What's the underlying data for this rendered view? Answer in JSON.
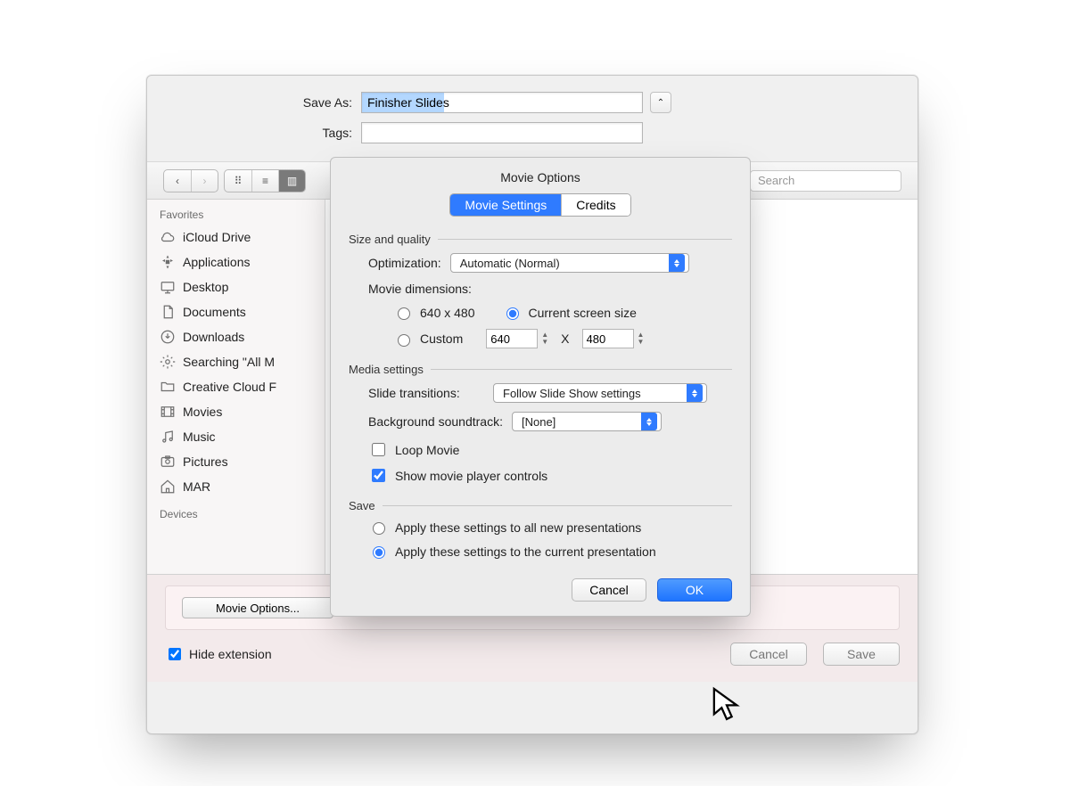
{
  "save_dialog": {
    "save_as_label": "Save As:",
    "save_as_value": "Finisher Slides",
    "tags_label": "Tags:",
    "tags_value": "",
    "search_placeholder": "Search",
    "favorites_header": "Favorites",
    "devices_header": "Devices",
    "favorites": [
      {
        "label": "iCloud Drive",
        "icon": "cloud"
      },
      {
        "label": "Applications",
        "icon": "apps"
      },
      {
        "label": "Desktop",
        "icon": "desktop"
      },
      {
        "label": "Documents",
        "icon": "document"
      },
      {
        "label": "Downloads",
        "icon": "download"
      },
      {
        "label": "Searching \"All M",
        "icon": "gear"
      },
      {
        "label": "Creative Cloud F",
        "icon": "folder"
      },
      {
        "label": "Movies",
        "icon": "movie"
      },
      {
        "label": "Music",
        "icon": "music"
      },
      {
        "label": "Pictures",
        "icon": "picture"
      },
      {
        "label": "MAR",
        "icon": "home"
      }
    ],
    "movie_options_button": "Movie Options...",
    "hide_extension_label": "Hide extension",
    "hide_extension_checked": true,
    "cancel_label": "Cancel",
    "save_label": "Save"
  },
  "sheet": {
    "title": "Movie Options",
    "tabs": {
      "active": "Movie Settings",
      "other": "Credits"
    },
    "size_quality": {
      "header": "Size and quality",
      "optimization_label": "Optimization:",
      "optimization_value": "Automatic (Normal)",
      "dimensions_label": "Movie dimensions:",
      "radio_640": "640 x 480",
      "radio_current": "Current screen size",
      "radio_custom": "Custom",
      "custom_w": "640",
      "custom_x": "X",
      "custom_h": "480",
      "selected": "current"
    },
    "media": {
      "header": "Media settings",
      "transitions_label": "Slide transitions:",
      "transitions_value": "Follow Slide Show settings",
      "soundtrack_label": "Background soundtrack:",
      "soundtrack_value": "[None]",
      "loop_label": "Loop Movie",
      "loop_checked": false,
      "controls_label": "Show movie player controls",
      "controls_checked": true
    },
    "save": {
      "header": "Save",
      "opt_all": "Apply these settings to all new presentations",
      "opt_current": "Apply these settings to the current presentation",
      "selected": "current"
    },
    "cancel": "Cancel",
    "ok": "OK"
  }
}
